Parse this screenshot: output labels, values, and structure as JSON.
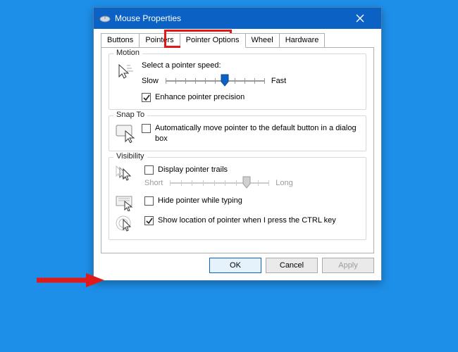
{
  "window": {
    "title": "Mouse Properties",
    "close": "✕"
  },
  "tabs": {
    "buttons": "Buttons",
    "pointers": "Pointers",
    "pointer_options": "Pointer Options",
    "wheel": "Wheel",
    "hardware": "Hardware"
  },
  "motion": {
    "legend": "Motion",
    "label": "Select a pointer speed:",
    "slow": "Slow",
    "fast": "Fast",
    "enhance": "Enhance pointer precision",
    "enhance_checked": true,
    "speed_value": 6,
    "speed_ticks": 11
  },
  "snap": {
    "legend": "Snap To",
    "label": "Automatically move pointer to the default button in a dialog box",
    "checked": false
  },
  "visibility": {
    "legend": "Visibility",
    "trails_label": "Display pointer trails",
    "trails_checked": false,
    "trails_short": "Short",
    "trails_long": "Long",
    "trails_value": 7,
    "trails_ticks": 10,
    "hide_label": "Hide pointer while typing",
    "hide_checked": false,
    "ctrl_label": "Show location of pointer when I press the CTRL key",
    "ctrl_checked": true
  },
  "actions": {
    "ok": "OK",
    "cancel": "Cancel",
    "apply": "Apply"
  }
}
